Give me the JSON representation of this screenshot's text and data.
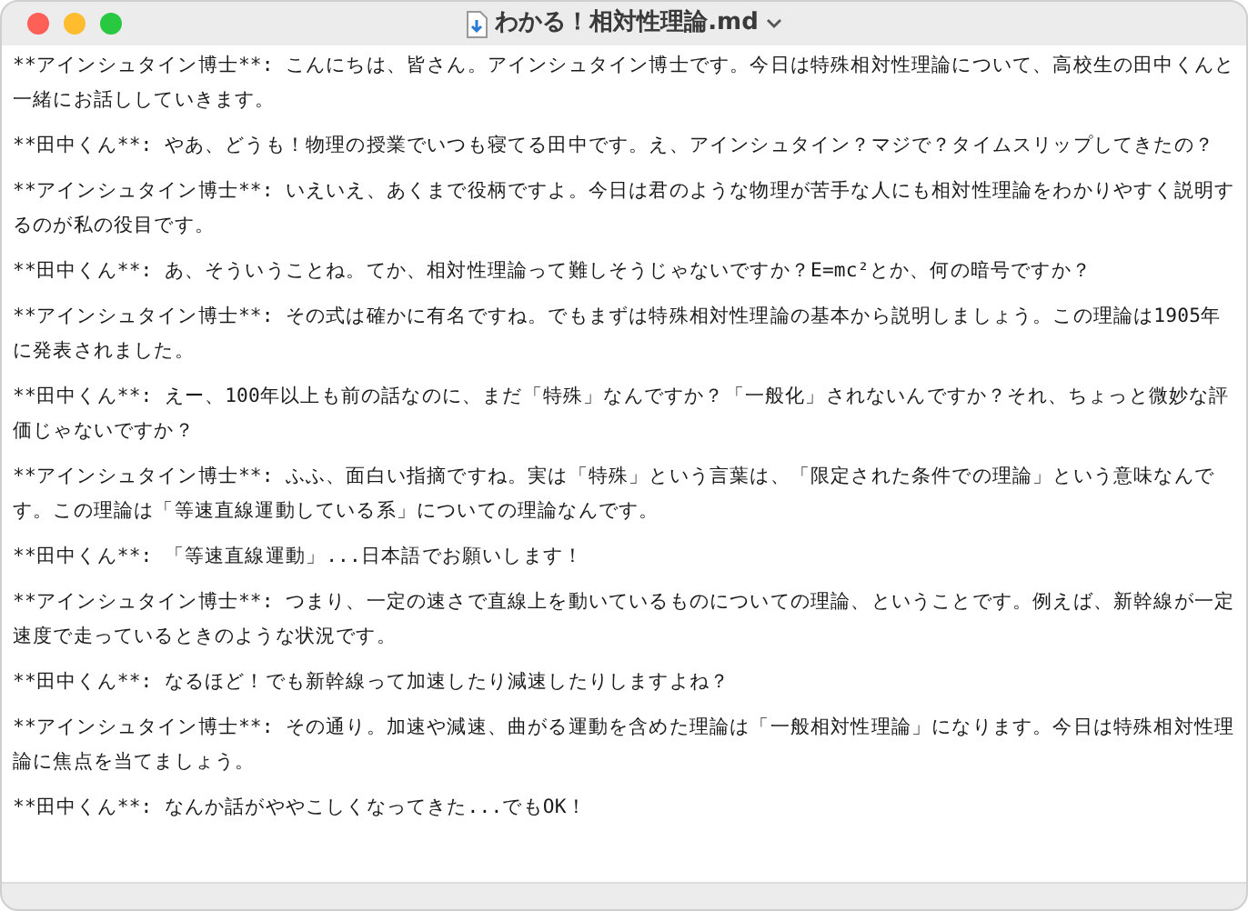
{
  "window": {
    "title": "わかる！相対性理論.md"
  },
  "paragraphs": [
    "**アインシュタイン博士**: こんにちは、皆さん。アインシュタイン博士です。今日は特殊相対性理論について、高校生の田中くんと一緒にお話ししていきます。",
    "**田中くん**: やあ、どうも！物理の授業でいつも寝てる田中です。え、アインシュタイン？マジで？タイムスリップしてきたの？",
    "**アインシュタイン博士**: いえいえ、あくまで役柄ですよ。今日は君のような物理が苦手な人にも相対性理論をわかりやすく説明するのが私の役目です。",
    "**田中くん**: あ、そういうことね。てか、相対性理論って難しそうじゃないですか？E=mc²とか、何の暗号ですか？",
    "**アインシュタイン博士**: その式は確かに有名ですね。でもまずは特殊相対性理論の基本から説明しましょう。この理論は1905年に発表されました。",
    "**田中くん**: えー、100年以上も前の話なのに、まだ「特殊」なんですか？「一般化」されないんですか？それ、ちょっと微妙な評価じゃないですか？",
    "**アインシュタイン博士**: ふふ、面白い指摘ですね。実は「特殊」という言葉は、「限定された条件での理論」という意味なんです。この理論は「等速直線運動している系」についての理論なんです。",
    "**田中くん**: 「等速直線運動」...日本語でお願いします！",
    "**アインシュタイン博士**: つまり、一定の速さで直線上を動いているものについての理論、ということです。例えば、新幹線が一定速度で走っているときのような状況です。",
    "**田中くん**: なるほど！でも新幹線って加速したり減速したりしますよね？",
    "**アインシュタイン博士**: その通り。加速や減速、曲がる運動を含めた理論は「一般相対性理論」になります。今日は特殊相対性理論に焦点を当てましょう。",
    "**田中くん**: なんか話がややこしくなってきた...でもOK！"
  ]
}
